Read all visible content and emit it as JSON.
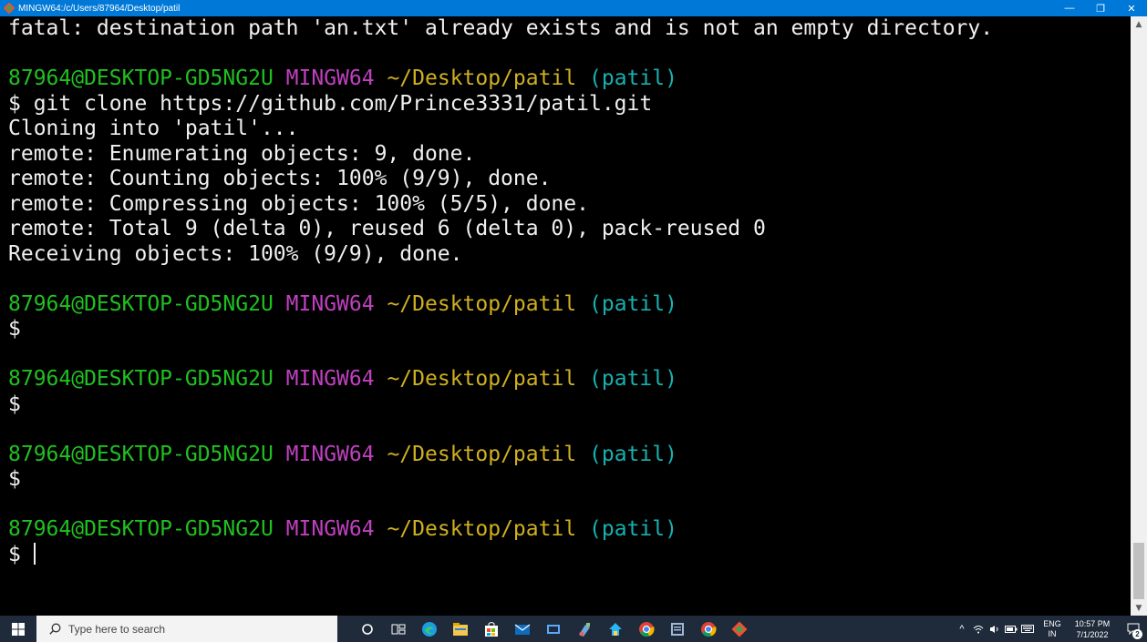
{
  "window": {
    "title": "MINGW64:/c/Users/87964/Desktop/patil",
    "minimize_glyph": "—",
    "maximize_glyph": "❐",
    "close_glyph": "✕"
  },
  "terminal": {
    "colors": {
      "user": "#20c020",
      "host": "#c040c0",
      "path": "#d0b020",
      "branch": "#18b0b0",
      "text": "#f0f0f0",
      "background": "#000000"
    },
    "lines": [
      {
        "kind": "text",
        "text": "fatal: destination path 'an.txt' already exists and is not an empty directory."
      },
      {
        "kind": "blank",
        "text": ""
      },
      {
        "kind": "prompt",
        "user": "87964@DESKTOP-GD5NG2U",
        "host": "MINGW64",
        "path": "~/Desktop/patil",
        "branch": "(patil)"
      },
      {
        "kind": "text",
        "text": "$ git clone https://github.com/Prince3331/patil.git"
      },
      {
        "kind": "text",
        "text": "Cloning into 'patil'..."
      },
      {
        "kind": "text",
        "text": "remote: Enumerating objects: 9, done."
      },
      {
        "kind": "text",
        "text": "remote: Counting objects: 100% (9/9), done."
      },
      {
        "kind": "text",
        "text": "remote: Compressing objects: 100% (5/5), done."
      },
      {
        "kind": "text",
        "text": "remote: Total 9 (delta 0), reused 6 (delta 0), pack-reused 0"
      },
      {
        "kind": "text",
        "text": "Receiving objects: 100% (9/9), done."
      },
      {
        "kind": "blank",
        "text": ""
      },
      {
        "kind": "prompt",
        "user": "87964@DESKTOP-GD5NG2U",
        "host": "MINGW64",
        "path": "~/Desktop/patil",
        "branch": "(patil)"
      },
      {
        "kind": "text",
        "text": "$"
      },
      {
        "kind": "blank",
        "text": ""
      },
      {
        "kind": "prompt",
        "user": "87964@DESKTOP-GD5NG2U",
        "host": "MINGW64",
        "path": "~/Desktop/patil",
        "branch": "(patil)"
      },
      {
        "kind": "text",
        "text": "$"
      },
      {
        "kind": "blank",
        "text": ""
      },
      {
        "kind": "prompt",
        "user": "87964@DESKTOP-GD5NG2U",
        "host": "MINGW64",
        "path": "~/Desktop/patil",
        "branch": "(patil)"
      },
      {
        "kind": "text",
        "text": "$"
      },
      {
        "kind": "blank",
        "text": ""
      },
      {
        "kind": "prompt",
        "user": "87964@DESKTOP-GD5NG2U",
        "host": "MINGW64",
        "path": "~/Desktop/patil",
        "branch": "(patil)"
      },
      {
        "kind": "input",
        "text": "$"
      }
    ]
  },
  "taskbar": {
    "search_placeholder": "Type here to search",
    "pinned_icons": [
      "cortana-icon",
      "task-view-icon",
      "edge-icon",
      "file-explorer-icon",
      "store-icon",
      "mail-icon",
      "media-player-icon",
      "paint-icon",
      "home-app-icon",
      "chrome-icon",
      "word-icon",
      "chrome-profile-icon",
      "git-bash-icon"
    ],
    "tray": {
      "language_line1": "ENG",
      "language_line2": "IN",
      "time": "10:57 PM",
      "date": "7/1/2022",
      "notification_count": "2"
    }
  }
}
